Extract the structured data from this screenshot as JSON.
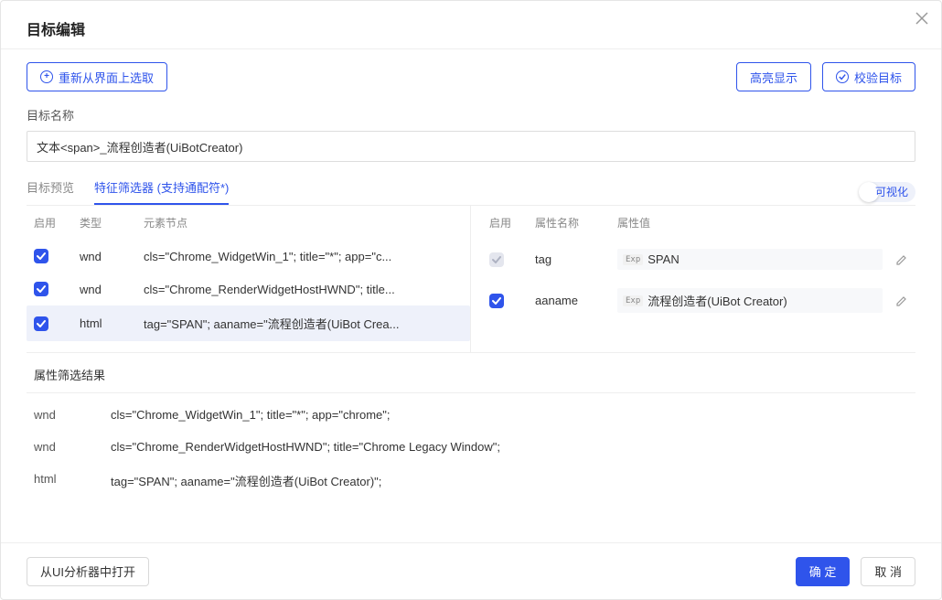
{
  "header": {
    "title": "目标编辑"
  },
  "buttons": {
    "reselect": "重新从界面上选取",
    "highlight": "高亮显示",
    "validate": "校验目标",
    "open_analyzer": "从UI分析器中打开",
    "ok": "确 定",
    "cancel": "取 消"
  },
  "target_name": {
    "label": "目标名称",
    "value": "文本<span>_流程创造者(UiBotCreator)"
  },
  "tabs": {
    "preview": "目标预览",
    "selector": "特征筛选器 (支持通配符*)"
  },
  "switch": {
    "visual": "可视化"
  },
  "left_table": {
    "head_enable": "启用",
    "head_type": "类型",
    "head_node": "元素节点",
    "rows": [
      {
        "checked": true,
        "type": "wnd",
        "node": "cls=\"Chrome_WidgetWin_1\"; title=\"*\"; app=\"c..."
      },
      {
        "checked": true,
        "type": "wnd",
        "node": "cls=\"Chrome_RenderWidgetHostHWND\"; title..."
      },
      {
        "checked": true,
        "type": "html",
        "node": "tag=\"SPAN\"; aaname=\"流程创造者(UiBot Crea...",
        "selected": true
      }
    ]
  },
  "right_table": {
    "head_enable": "启用",
    "head_attrname": "属性名称",
    "head_attrval": "属性值",
    "rows": [
      {
        "checked": true,
        "locked": true,
        "name": "tag",
        "badge": "Exp",
        "value": "SPAN"
      },
      {
        "checked": true,
        "locked": false,
        "name": "aaname",
        "badge": "Exp",
        "value": "流程创造者(UiBot Creator)"
      }
    ]
  },
  "results": {
    "title": "属性筛选结果",
    "rows": [
      {
        "type": "wnd",
        "selector": "cls=\"Chrome_WidgetWin_1\"; title=\"*\"; app=\"chrome\";"
      },
      {
        "type": "wnd",
        "selector": "cls=\"Chrome_RenderWidgetHostHWND\"; title=\"Chrome Legacy Window\";"
      },
      {
        "type": "html",
        "selector": "tag=\"SPAN\"; aaname=\"流程创造者(UiBot Creator)\";"
      }
    ]
  }
}
